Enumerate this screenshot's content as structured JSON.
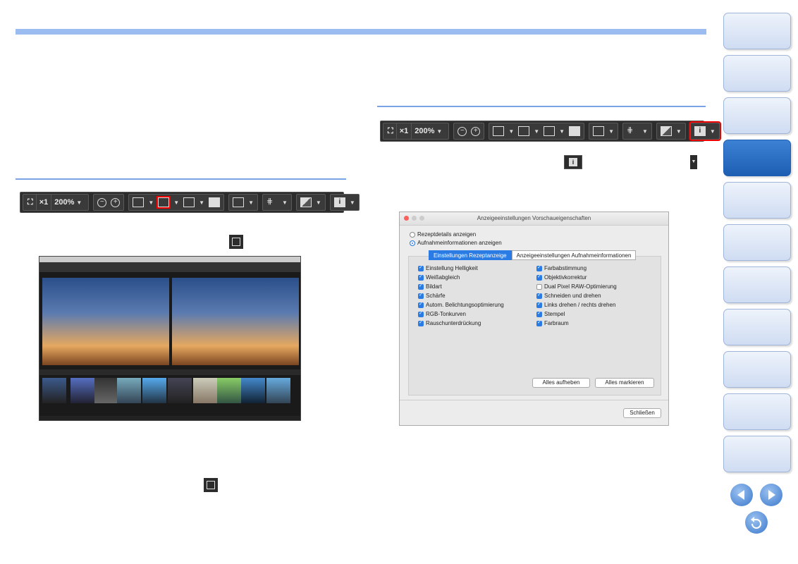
{
  "toolbar": {
    "fit_label": "",
    "x1_label": "×1",
    "zoom_label": "200%",
    "zoom_out_label": "−",
    "zoom_in_label": "+"
  },
  "dialog": {
    "title": "Anzeigeeinstellungen Vorschaueigenschaften",
    "radio1": "Rezeptdetails anzeigen",
    "radio2": "Aufnahmeinformationen anzeigen",
    "tab1": "Einstellungen Rezeptanzeige",
    "tab2": "Anzeigeeinstellungen Aufnahmeinformationen",
    "left_items": [
      "Einstellung Helligkeit",
      "Weißabgleich",
      "Bildart",
      "Schärfe",
      "Autom. Belichtungsoptimierung",
      "RGB-Tonkurven",
      "Rauschunterdrückung"
    ],
    "right_items": [
      "Farbabstimmung",
      "Objektivkorrektur",
      "Dual Pixel RAW-Optimierung",
      "Schneiden und drehen",
      "Links drehen / rechts drehen",
      "Stempel",
      "Farbraum"
    ],
    "btn_clear": "Alles aufheben",
    "btn_mark": "Alles markieren",
    "btn_close": "Schließen"
  },
  "colors": {
    "accent": "#2b7be5",
    "highlight": "#e00000",
    "sidebar_active": "#1d5eb3"
  }
}
